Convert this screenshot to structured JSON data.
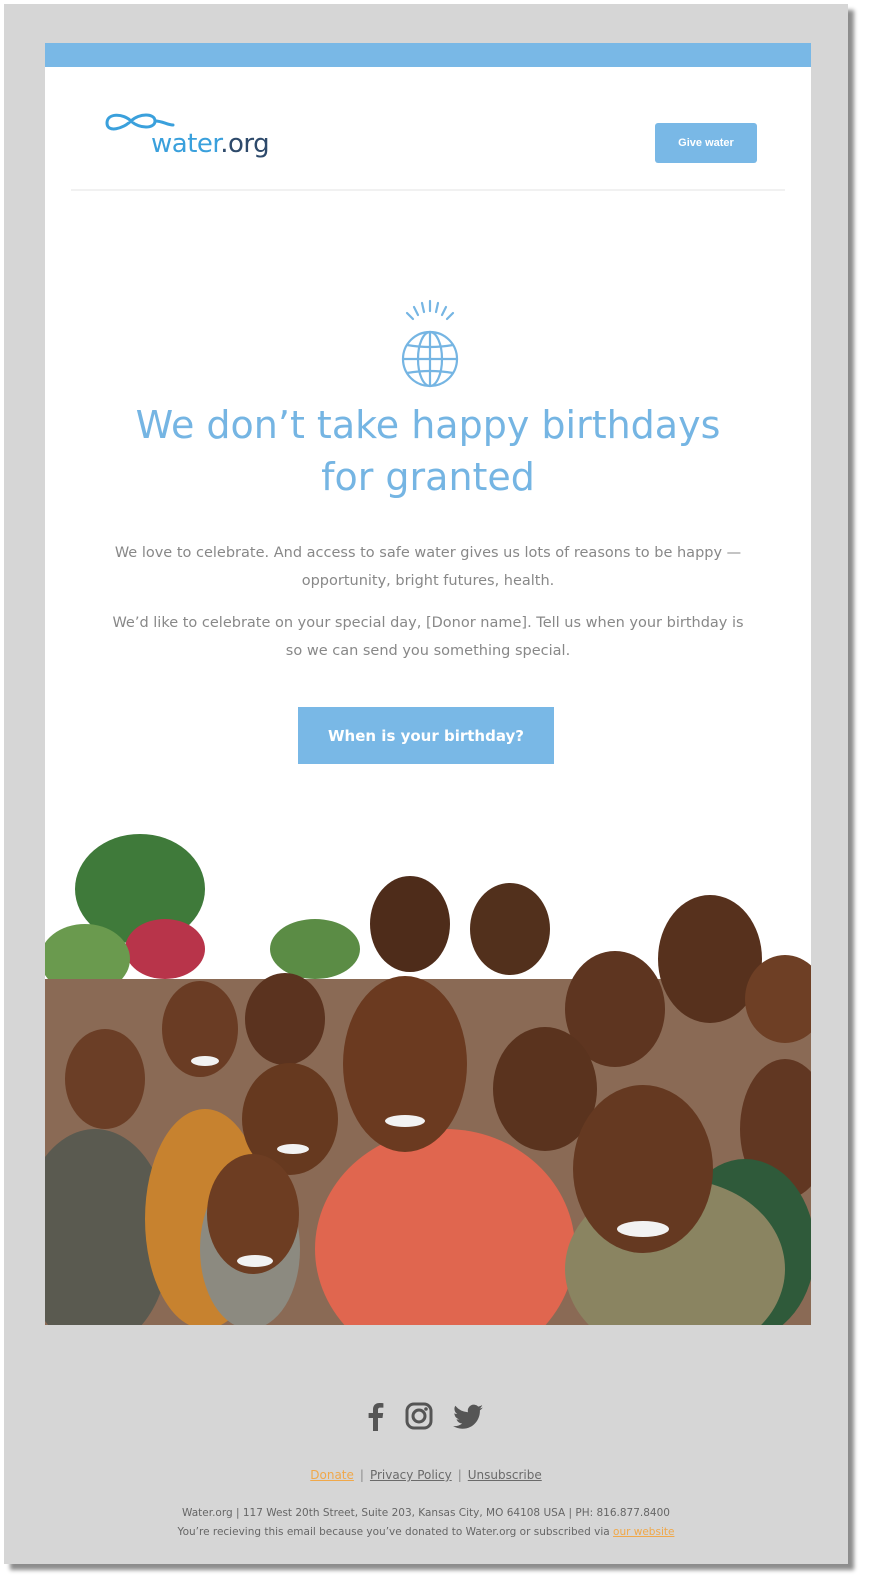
{
  "header": {
    "logo_text": "water",
    "logo_text_suffix": ".org",
    "give_button": "Give water"
  },
  "hero": {
    "headline": "We don’t take happy birthdays for granted",
    "paragraph_1": "We love to celebrate. And access to safe water gives us lots of reasons to be happy — opportunity, bright futures, health.",
    "paragraph_2": "We’d like to celebrate on your special day, [Donor name]. Tell us when your birthday is so we can send you something special.",
    "cta_label": "When is your birthday?"
  },
  "footer": {
    "social_icons": [
      "facebook-icon",
      "instagram-icon",
      "twitter-icon"
    ],
    "links": {
      "donate": "Donate",
      "privacy": "Privacy Policy",
      "unsubscribe": "Unsubscribe"
    },
    "address_line": "Water.org | 117 West 20th Street, Suite 203, Kansas City, MO 64108 USA | PH: 816.877.8400",
    "notice_text": "You’re recieving this email because you’ve donated to Water.org or subscribed via",
    "notice_link": "our website"
  },
  "colors": {
    "accent_blue": "#79b8e6",
    "headline_blue": "#75b5e3",
    "link_orange": "#f0a84a",
    "outer_gray": "#d6d6d6"
  }
}
